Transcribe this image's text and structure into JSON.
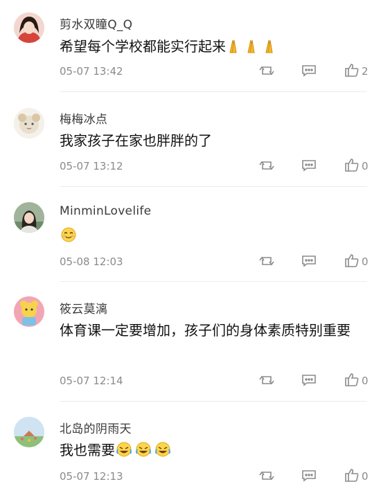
{
  "comments": [
    {
      "username": "剪水双瞳Q_Q",
      "text": "希望每个学校都能实行起来",
      "emoji": "pray-emoji x3",
      "time": "05-07 13:42",
      "likes": "2"
    },
    {
      "username": "梅梅冰点",
      "text": "我家孩子在家也胖胖的了",
      "time": "05-07 13:12",
      "likes": "0"
    },
    {
      "username": "MinminLovelife",
      "text": "",
      "emoji": "smile-emoji",
      "time": "05-08 12:03",
      "likes": "0"
    },
    {
      "username": "筱云莫漓",
      "text": "体育课一定要增加，孩子们的身体素质特别重要",
      "time": "05-07 12:14",
      "likes": "0"
    },
    {
      "username": "北岛的阴雨天",
      "text": "我也需要",
      "emoji": "laugh-cry-emoji x3",
      "time": "05-07 12:13",
      "likes": "0"
    }
  ],
  "icons": {
    "repost": "repost-icon",
    "comment": "comment-icon",
    "like": "thumbs-up-icon"
  }
}
